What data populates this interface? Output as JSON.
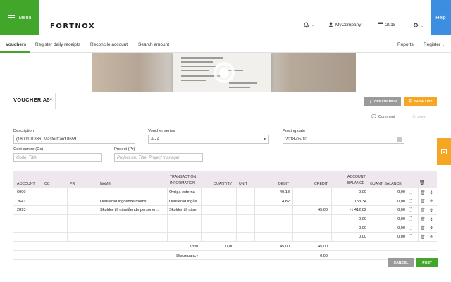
{
  "header": {
    "menu_label": "Menu",
    "logo_text": "FORTNOX",
    "company": "MyCompany",
    "year": "2018",
    "help_label": "Help"
  },
  "subnav": {
    "tabs": [
      "Vouchers",
      "Register daily receipts",
      "Reconcile account",
      "Search amount"
    ],
    "reports": "Reports",
    "register": "Register"
  },
  "voucher": {
    "title": "VOUCHER A5*",
    "create_new": "CREATE NEW",
    "show_list": "SHOW LIST",
    "comment": "Comment",
    "print": "Print"
  },
  "form": {
    "description_label": "Description",
    "description_value": "(1800101836) MasterCard 8659",
    "series_label": "Voucher series",
    "series_value": "A - A",
    "date_label": "Posting date",
    "date_value": "2018-05-10",
    "cc_label": "Cost centre (Cc)",
    "cc_placeholder": "Code, Title",
    "project_label": "Project (Pr)",
    "project_placeholder": "Project nn, Title, Project manager"
  },
  "table": {
    "headers": {
      "account": "ACCOUNT",
      "cc": "CC",
      "pr": "PR",
      "name": "NAME",
      "trans1": "TRANSACTION",
      "trans2": "INFORMATION",
      "quantity": "QUANTITY",
      "unit": "UNIT",
      "debit": "DEBIT",
      "credit": "CREDIT",
      "acc_bal1": "ACCOUNT",
      "acc_bal2": "BALANCE",
      "quant_bal": "QUANT. BALANCE"
    },
    "rows": [
      {
        "account": "6900",
        "name": "",
        "info": "Övriga externa",
        "debit": "40,18",
        "credit": "",
        "balance": "0,00",
        "qbal": "0,00"
      },
      {
        "account": "2641",
        "name": "Debiterad ingoende moms",
        "info": "Debiterad ingåe",
        "debit": "4,82",
        "credit": "",
        "balance": "153,34",
        "qbal": "0,00"
      },
      {
        "account": "2893",
        "name": "Skulder till närstående personer...",
        "info": "Skulder till näre",
        "debit": "",
        "credit": "45,00",
        "balance": "-1 412,02",
        "qbal": "0,00"
      },
      {
        "account": "",
        "name": "",
        "info": "",
        "debit": "",
        "credit": "",
        "balance": "0,00",
        "qbal": "0,00"
      },
      {
        "account": "",
        "name": "",
        "info": "",
        "debit": "",
        "credit": "",
        "balance": "0,00",
        "qbal": "0,00"
      },
      {
        "account": "",
        "name": "",
        "info": "",
        "debit": "",
        "credit": "",
        "balance": "0,00",
        "qbal": "0,00"
      }
    ],
    "total_label": "Total",
    "total_quantity": "0,00",
    "total_debit": "45,00",
    "total_credit": "45,00",
    "discrepancy_label": "Discrepancy",
    "discrepancy_value": "0,00"
  },
  "footer": {
    "cancel": "CANCEL",
    "post": "POST"
  }
}
